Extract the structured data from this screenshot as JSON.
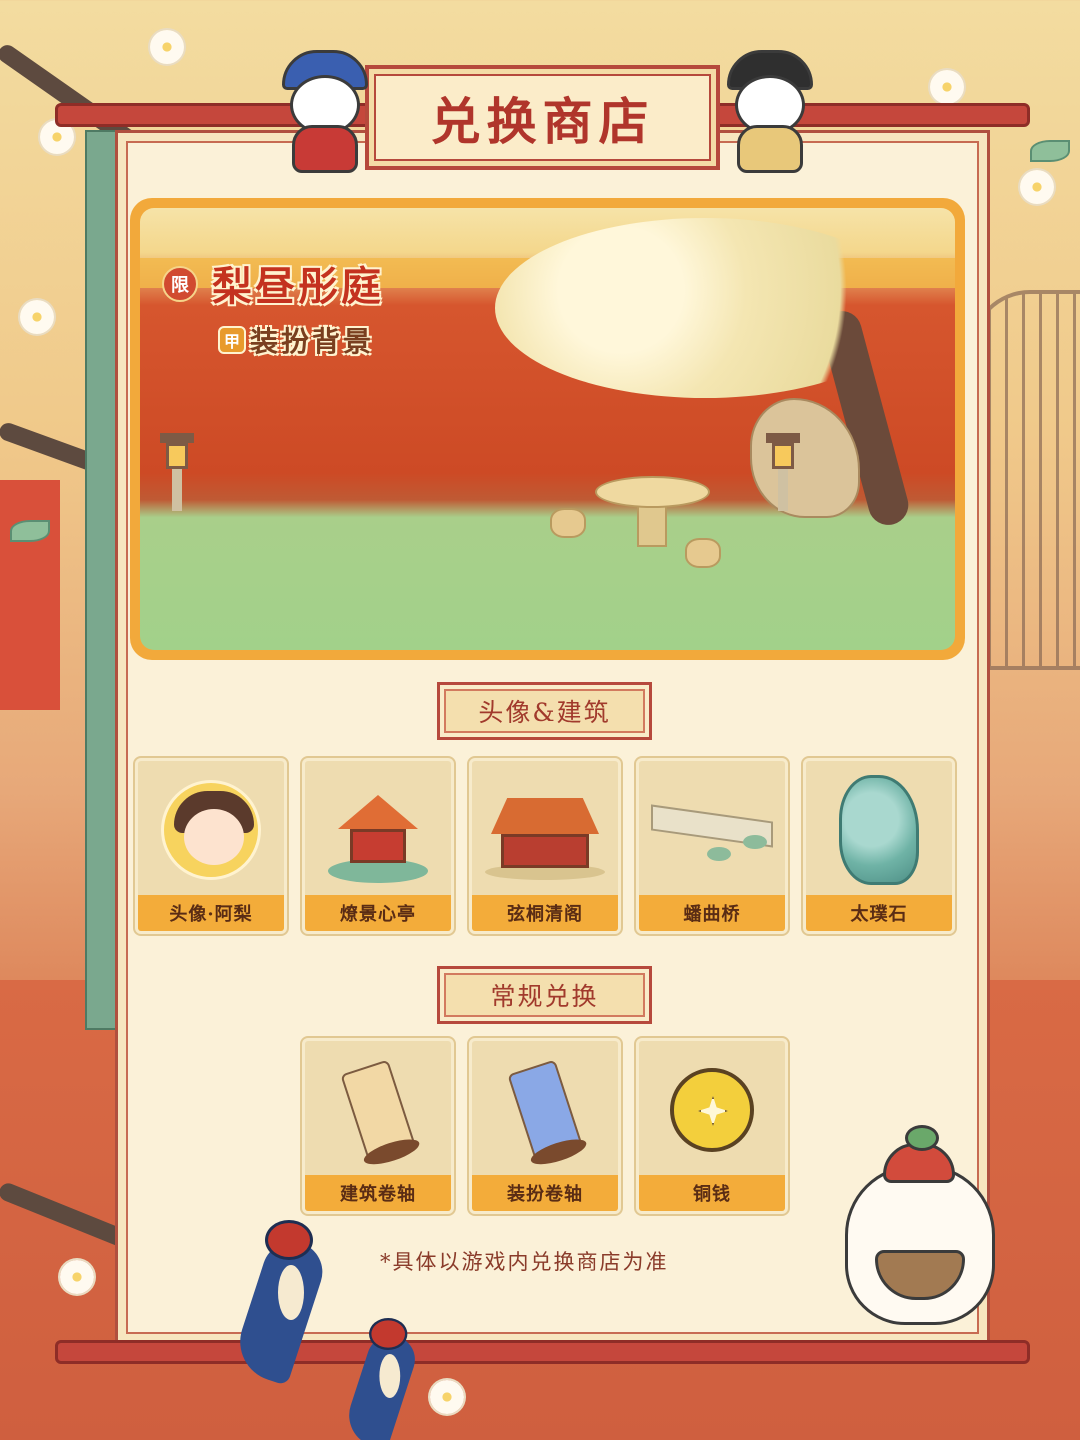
{
  "title": "兑换商店",
  "banner": {
    "limited_tag": "限",
    "name": "梨昼彤庭",
    "type_tag": "甲",
    "category": "装扮背景"
  },
  "sections": {
    "avatar_building": {
      "header": "头像&建筑",
      "items": [
        {
          "label": "头像·阿梨",
          "icon": "avatar-portrait-icon"
        },
        {
          "label": "燎景心亭",
          "icon": "pavilion-icon"
        },
        {
          "label": "弦桐清阁",
          "icon": "pavilion-hall-icon"
        },
        {
          "label": "蟠曲桥",
          "icon": "bridge-icon"
        },
        {
          "label": "太璞石",
          "icon": "rock-icon"
        }
      ]
    },
    "regular": {
      "header": "常规兑换",
      "items": [
        {
          "label": "建筑卷轴",
          "icon": "building-scroll-icon"
        },
        {
          "label": "装扮卷轴",
          "icon": "dress-scroll-icon"
        },
        {
          "label": "铜钱",
          "icon": "copper-coin-icon"
        }
      ]
    }
  },
  "disclaimer": "*具体以游戏内兑换商店为准",
  "colors": {
    "title_red": "#b0352b",
    "label_orange": "#f3ac3a",
    "panel_bg": "#fbf1d8",
    "rod_red": "#c5473c"
  }
}
